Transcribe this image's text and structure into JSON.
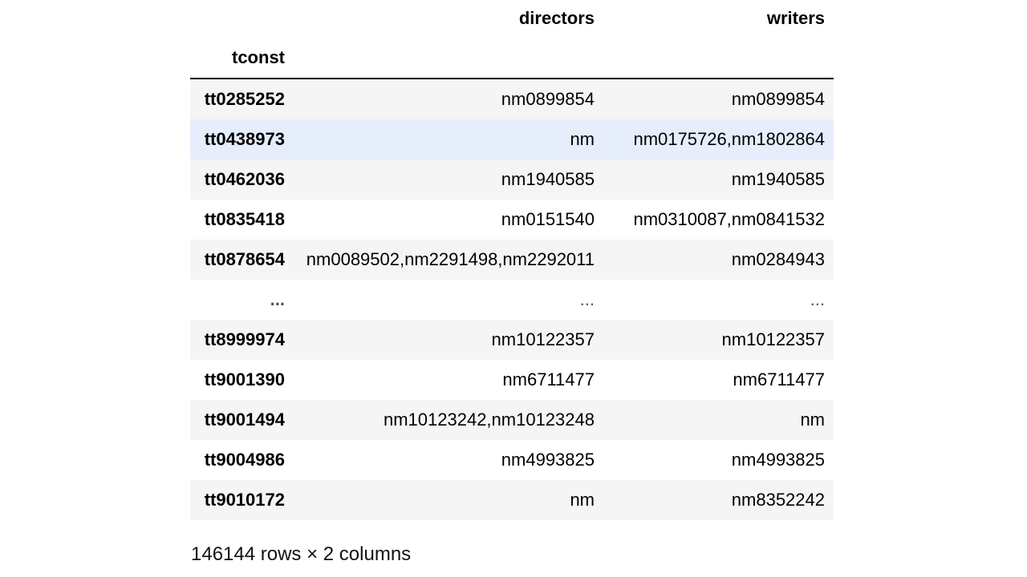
{
  "table": {
    "columns": [
      "directors",
      "writers"
    ],
    "index_name": "tconst",
    "rows": [
      {
        "index": "tt0285252",
        "directors": "nm0899854",
        "writers": "nm0899854"
      },
      {
        "index": "tt0438973",
        "directors": "nm",
        "writers": "nm0175726,nm1802864"
      },
      {
        "index": "tt0462036",
        "directors": "nm1940585",
        "writers": "nm1940585"
      },
      {
        "index": "tt0835418",
        "directors": "nm0151540",
        "writers": "nm0310087,nm0841532"
      },
      {
        "index": "tt0878654",
        "directors": "nm0089502,nm2291498,nm2292011",
        "writers": "nm0284943"
      },
      {
        "index": "...",
        "directors": "...",
        "writers": "..."
      },
      {
        "index": "tt8999974",
        "directors": "nm10122357",
        "writers": "nm10122357"
      },
      {
        "index": "tt9001390",
        "directors": "nm6711477",
        "writers": "nm6711477"
      },
      {
        "index": "tt9001494",
        "directors": "nm10123242,nm10123248",
        "writers": "nm"
      },
      {
        "index": "tt9004986",
        "directors": "nm4993825",
        "writers": "nm4993825"
      },
      {
        "index": "tt9010172",
        "directors": "nm",
        "writers": "nm8352242"
      }
    ]
  },
  "footer": {
    "shape_text": "146144 rows × 2 columns"
  },
  "colors": {
    "striped_row": "#f5f5f5",
    "hover_row": "#e6edfb",
    "header_rule": "#000000"
  }
}
